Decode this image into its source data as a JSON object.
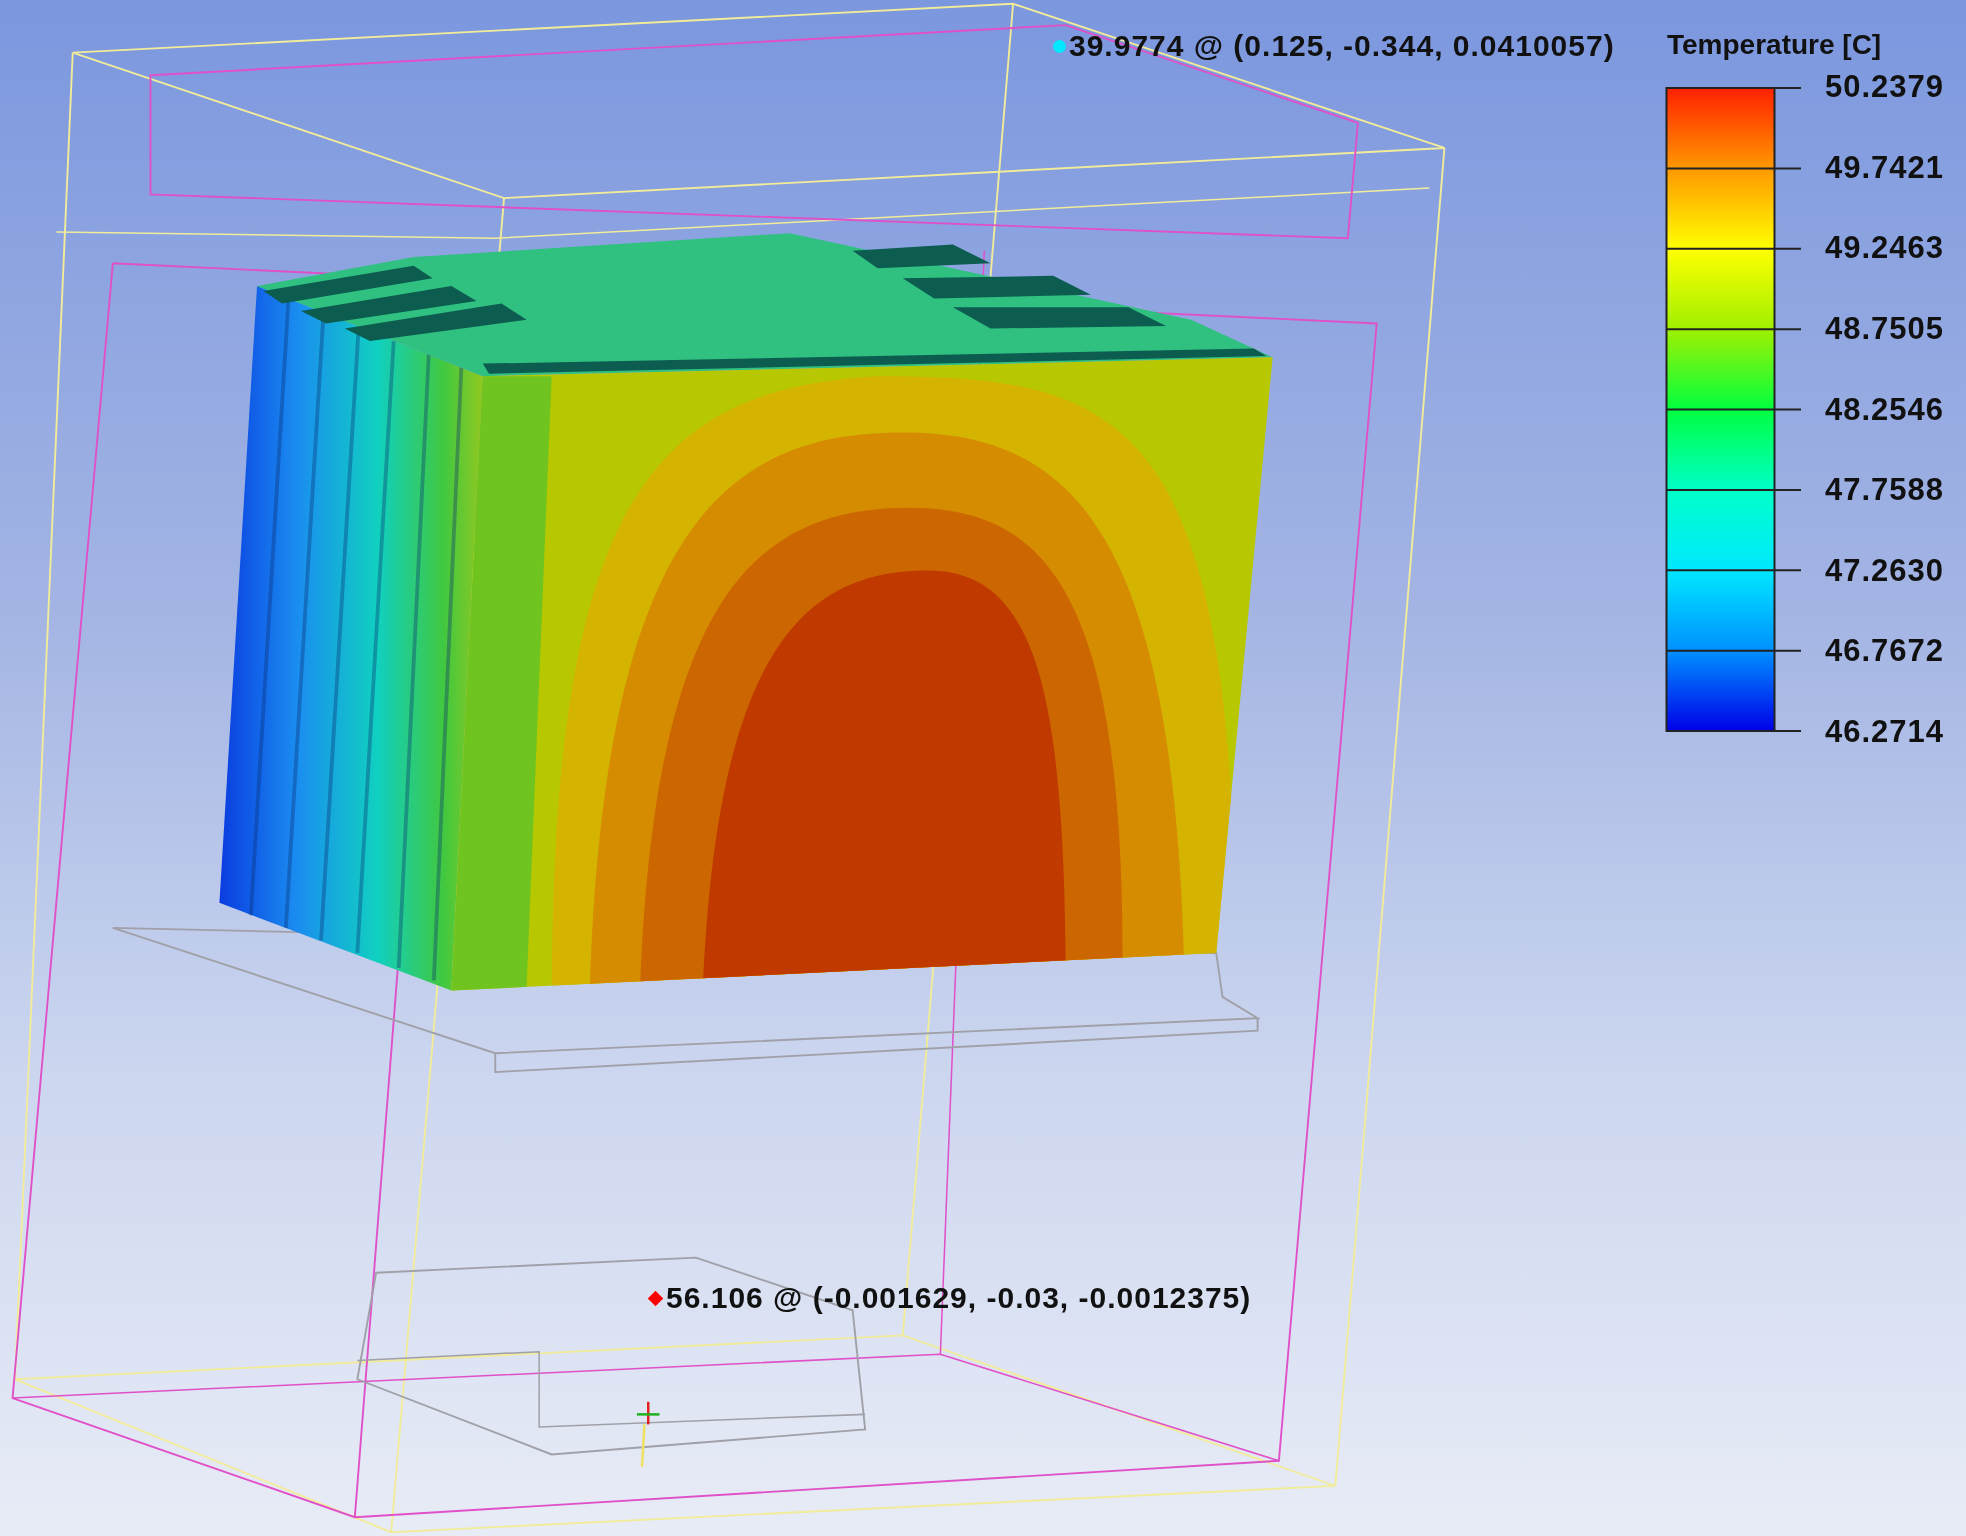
{
  "viewport": {
    "probes": [
      {
        "kind": "dot",
        "color": "#00e8ff",
        "label": "39.9774 @ (0.125, -0.344, 0.0410057)"
      },
      {
        "kind": "diamond",
        "color": "#ff0000",
        "label": "56.106 @ (-0.001629, -0.03, -0.0012375)"
      }
    ]
  },
  "legend": {
    "title": "Temperature [C]",
    "ticks": [
      "50.2379",
      "49.7421",
      "49.2463",
      "48.7505",
      "48.2546",
      "47.7588",
      "47.2630",
      "46.7672",
      "46.2714"
    ]
  }
}
